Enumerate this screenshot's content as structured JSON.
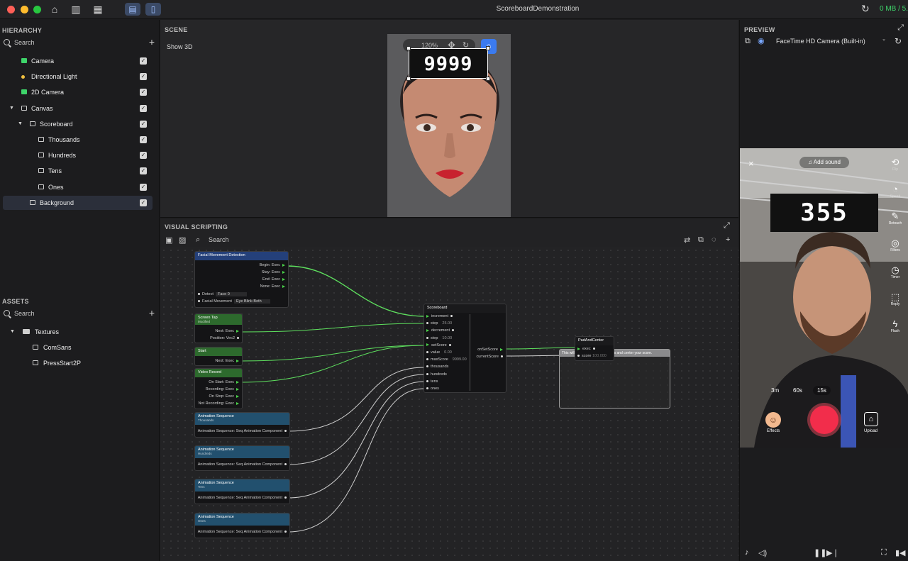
{
  "window": {
    "title": "ScoreboardDemonstration",
    "memory": "0 MB / 5...",
    "colors": {
      "close": "#ff5f57",
      "minimize": "#febc2e",
      "zoom": "#28c840",
      "accent": "#3b7bf0",
      "exec_pin": "#4ad14a"
    }
  },
  "hierarchy": {
    "title": "HIERARCHY",
    "search_placeholder": "Search",
    "items": [
      {
        "label": "Camera",
        "icon": "camera-icon",
        "indent": 0,
        "checked": true
      },
      {
        "label": "Directional Light",
        "icon": "light-icon",
        "indent": 0,
        "checked": true
      },
      {
        "label": "2D Camera",
        "icon": "camera-icon",
        "indent": 0,
        "checked": true
      },
      {
        "label": "Canvas",
        "icon": "canvas-icon",
        "indent": 0,
        "expanded": true,
        "checked": true
      },
      {
        "label": "Scoreboard",
        "icon": "image-icon",
        "indent": 1,
        "expanded": true,
        "checked": true
      },
      {
        "label": "Thousands",
        "icon": "image-icon",
        "indent": 2,
        "checked": true
      },
      {
        "label": "Hundreds",
        "icon": "image-icon",
        "indent": 2,
        "checked": true
      },
      {
        "label": "Tens",
        "icon": "image-icon",
        "indent": 2,
        "checked": true
      },
      {
        "label": "Ones",
        "icon": "image-icon",
        "indent": 2,
        "checked": true
      },
      {
        "label": "Background",
        "icon": "image-icon",
        "indent": 1,
        "checked": true,
        "selected": true
      }
    ]
  },
  "assets": {
    "title": "ASSETS",
    "search_placeholder": "Search",
    "folder": "Textures",
    "items": [
      "ComSans",
      "PressStart2P"
    ]
  },
  "scene": {
    "title": "SCENE",
    "show3d": "Show 3D",
    "zoom": "120%",
    "score_text": "9999"
  },
  "visual_scripting": {
    "title": "VISUAL SCRIPTING",
    "search_placeholder": "Search",
    "nodes": {
      "facial": {
        "title": "Facial Movement Detection",
        "outputs": [
          "Begin: Exec",
          "Stay: Exec",
          "End: Exec",
          "None: Exec"
        ],
        "detect_label": "Detect",
        "detect_value": "Face 0",
        "movement_label": "Facial Movement",
        "movement_value": "Eye Blink Both"
      },
      "tap": {
        "title": "Screen Tap",
        "subtitle": "Modified",
        "outputs": [
          "Next: Exec",
          "Position: Vec2"
        ]
      },
      "start": {
        "title": "Start",
        "outputs": [
          "Next: Exec"
        ]
      },
      "video": {
        "title": "Video Record",
        "outputs": [
          "On Start: Exec",
          "Recording: Exec",
          "On Stop: Exec",
          "Not Recording: Exec"
        ]
      },
      "anim1": {
        "title": "Animation Sequence",
        "subtitle": "Thousands",
        "output": "Animation Sequence: Seq Animation Component"
      },
      "anim2": {
        "title": "Animation Sequence",
        "subtitle": "Hundreds",
        "output": "Animation Sequence: Seq Animation Component"
      },
      "anim3": {
        "title": "Animation Sequence",
        "subtitle": "Tens",
        "output": "Animation Sequence: Seq Animation Component"
      },
      "anim4": {
        "title": "Animation Sequence",
        "subtitle": "Ones",
        "output": "Animation Sequence: Seq Animation Component"
      },
      "scoreboard": {
        "title": "Scoreboard",
        "inputs": [
          {
            "label": "increment",
            "value": ""
          },
          {
            "label": "step",
            "value": "25.00"
          },
          {
            "label": "decrement",
            "value": ""
          },
          {
            "label": "step",
            "value": "10.00"
          },
          {
            "label": "setScore",
            "value": ""
          },
          {
            "label": "value",
            "value": "0.00"
          },
          {
            "label": "maxScore",
            "value": "9999.00"
          },
          {
            "label": "thousands",
            "value": ""
          },
          {
            "label": "hundreds",
            "value": ""
          },
          {
            "label": "tens",
            "value": ""
          },
          {
            "label": "ones",
            "value": ""
          }
        ],
        "outputs": [
          "onSetScore",
          "currentScore"
        ]
      },
      "comment": "This will hide the \"padding\" zeroes and center your score.",
      "padcenter": {
        "title": "PadAndCenter",
        "inputs": [
          "exec",
          "score"
        ],
        "score_value": "100.000"
      }
    }
  },
  "preview": {
    "title": "PREVIEW",
    "camera": "FaceTime HD Camera (Built-in)",
    "add_sound": "Add sound",
    "score_text": "355",
    "side_items": [
      "Flip",
      "Speed",
      "Retouch",
      "Filters",
      "Timer",
      "Reply",
      "Flash"
    ],
    "durations": [
      "3m",
      "60s",
      "15s"
    ],
    "effects": "Effects",
    "upload": "Upload"
  }
}
